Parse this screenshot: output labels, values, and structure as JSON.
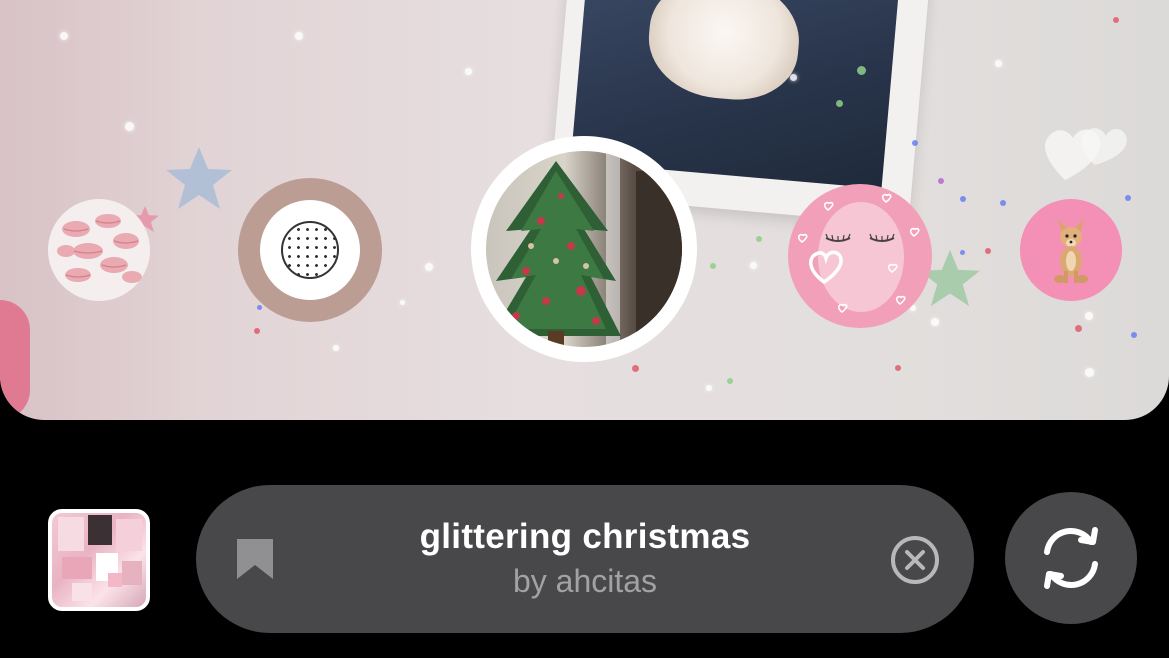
{
  "effect": {
    "title": "glittering christmas",
    "author": "by ahcitas"
  },
  "filters": [
    {
      "name": "pink kisses",
      "icon": "lips-icon"
    },
    {
      "name": "beige dots",
      "icon": "dotted-circle-icon"
    },
    {
      "name": "glittering christmas",
      "icon": "christmas-tree-icon",
      "selected": true
    },
    {
      "name": "eyelashes hearts",
      "icon": "eyelash-face-icon"
    },
    {
      "name": "chihuahua",
      "icon": "dog-icon"
    }
  ],
  "controls": {
    "save_icon": "bookmark-icon",
    "close_icon": "close-circle-icon",
    "flip_icon": "switch-camera-icon",
    "gallery_icon": "gallery-thumbnail"
  },
  "colors": {
    "pill_background": "#48484a",
    "title": "#ffffff",
    "author": "#a2a2a5",
    "selected_ring": "#ffffff"
  }
}
